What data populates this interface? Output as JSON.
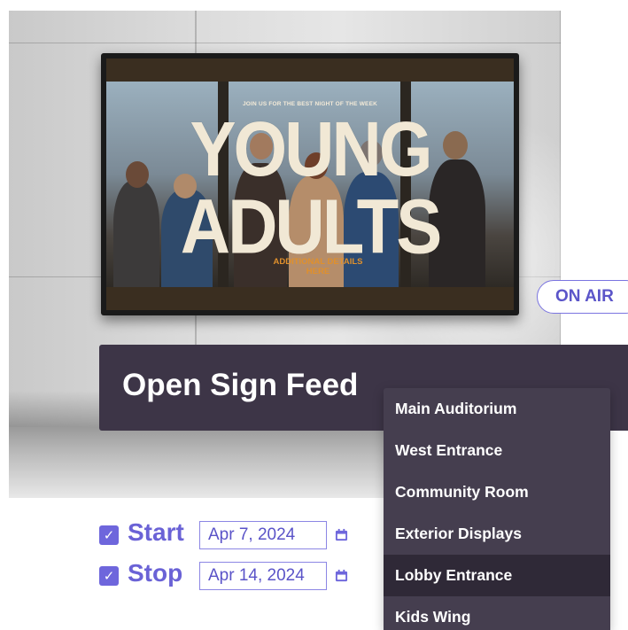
{
  "signage": {
    "tagline": "JOIN US FOR THE BEST NIGHT OF THE WEEK",
    "headline": "YOUNG ADULTS",
    "details": "ADDITIONAL DETAILS HERE"
  },
  "status": {
    "on_air_label": "ON AIR"
  },
  "feed": {
    "title": "Open Sign Feed"
  },
  "locations": [
    {
      "label": "Main Auditorium"
    },
    {
      "label": "West Entrance"
    },
    {
      "label": "Community Room"
    },
    {
      "label": "Exterior Displays"
    },
    {
      "label": "Lobby Entrance",
      "selected": true
    },
    {
      "label": "Kids Wing"
    }
  ],
  "schedule": {
    "start": {
      "label": "Start",
      "checked": true,
      "date": "Apr 7, 2024"
    },
    "stop": {
      "label": "Stop",
      "checked": true,
      "date": "Apr 14, 2024"
    }
  },
  "icons": {
    "checkbox": "check-icon",
    "calendar": "calendar-icon"
  },
  "colors": {
    "accent": "#6e66dc",
    "feed_bar": "#3d3547",
    "dropdown_bg": "#453e4f",
    "dropdown_active": "#2f2937",
    "details_orange": "#e0902c"
  }
}
